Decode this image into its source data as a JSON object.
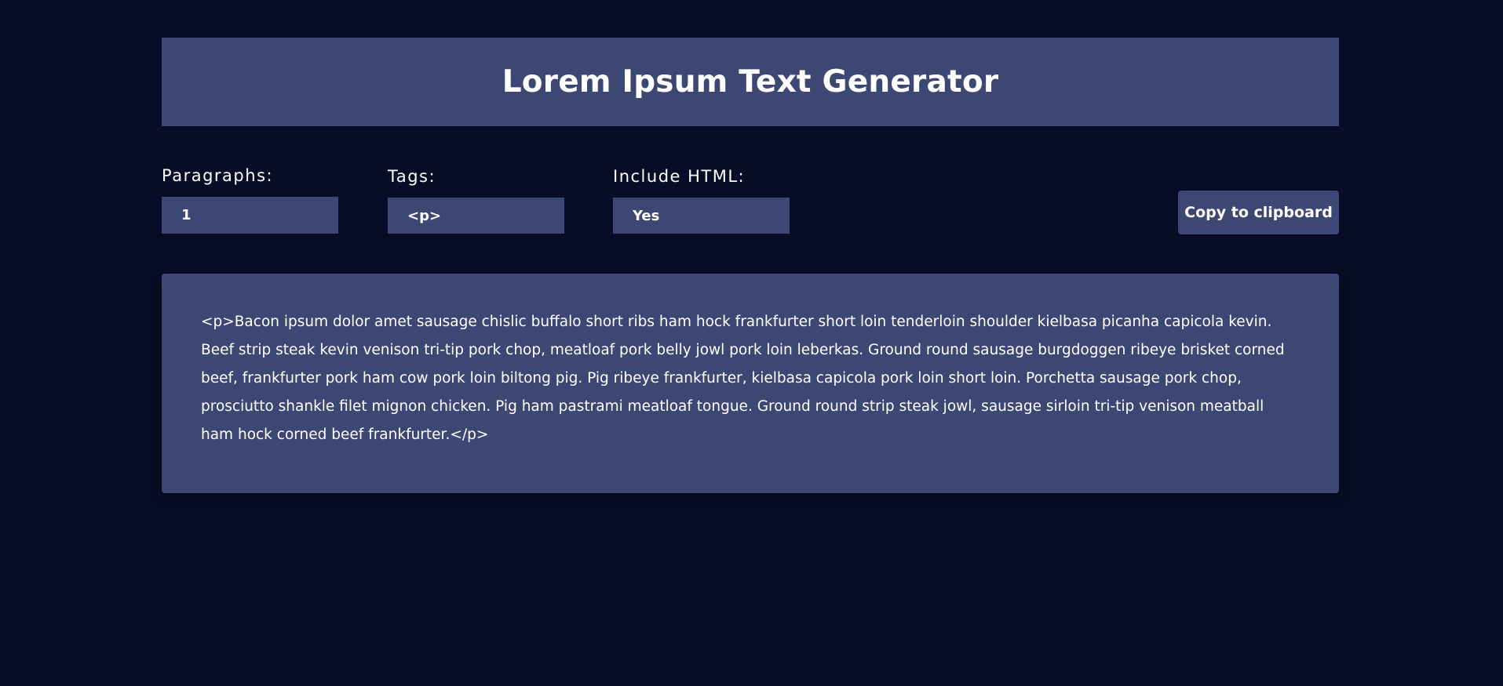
{
  "header": {
    "title": "Lorem Ipsum Text Generator"
  },
  "controls": {
    "paragraphs": {
      "label": "Paragraphs:",
      "value": "1"
    },
    "tags": {
      "label": "Tags:",
      "value": "<p>"
    },
    "include_html": {
      "label": "Include HTML:",
      "value": "Yes"
    },
    "copy_button": {
      "label": "Copy to clipboard"
    }
  },
  "output": {
    "text": "<p>Bacon ipsum dolor amet sausage chislic buffalo short ribs ham hock frankfurter short loin tenderloin shoulder kielbasa picanha capicola kevin. Beef strip steak kevin venison tri-tip pork chop, meatloaf pork belly jowl pork loin leberkas. Ground round sausage burgdoggen ribeye brisket corned beef, frankfurter pork ham cow pork loin biltong pig. Pig ribeye frankfurter, kielbasa capicola pork loin short loin. Porchetta sausage pork chop, prosciutto shankle filet mignon chicken. Pig ham pastrami meatloaf tongue. Ground round strip steak jowl, sausage sirloin tri-tip venison meatball ham hock corned beef frankfurter.</p>"
  },
  "colors": {
    "background": "#070d26",
    "panel": "#3c4873",
    "text": "#ffffff"
  }
}
